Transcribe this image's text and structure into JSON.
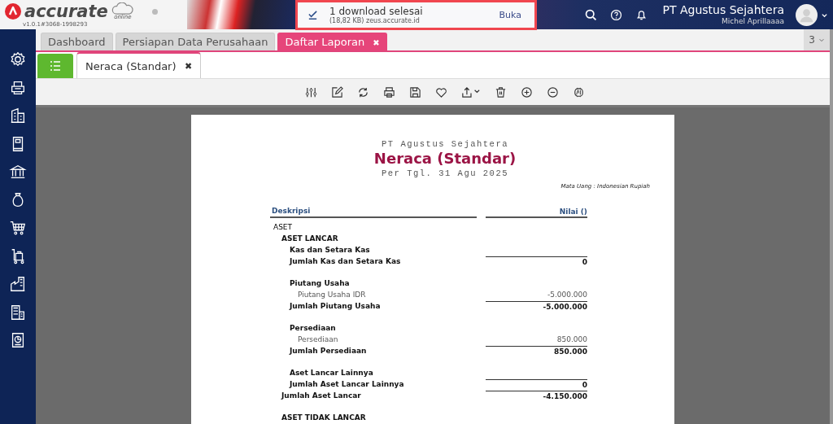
{
  "header": {
    "logo": "accurate",
    "logo_sub": "online",
    "version": "v1.0.1#3068-1998293",
    "company": "PT Agustus Sejahtera",
    "user": "Michel Aprillaaaa"
  },
  "download_popup": {
    "title": "1 download selesai",
    "detail": "(18,82 KB) zeus.accurate.id",
    "action": "Buka"
  },
  "tabs": [
    {
      "label": "Dashboard",
      "selected": false
    },
    {
      "label": "Persiapan Data Perusahaan",
      "selected": false
    },
    {
      "label": "Daftar Laporan",
      "selected": true,
      "close": "✖"
    }
  ],
  "tab_count": "3",
  "subtabs": [
    {
      "label": "Neraca (Standar)",
      "selected": true,
      "close": "✖"
    }
  ],
  "report": {
    "company": "PT Agustus Sejahtera",
    "title": "Neraca (Standar)",
    "date": "Per Tgl. 31 Agu 2025",
    "currency": "Mata Uang : Indonesian Rupiah",
    "columns": [
      "Deskripsi",
      "Nilai ()"
    ],
    "rows": [
      {
        "kind": "group",
        "label": "ASET",
        "children": [
          {
            "kind": "group",
            "label": "ASET LANCAR",
            "children": [
              {
                "kind": "group",
                "label": "Kas dan Setara Kas",
                "total": {
                  "label": "Jumlah Kas dan Setara Kas",
                  "value": "0"
                }
              },
              {
                "kind": "group",
                "label": "Piutang Usaha",
                "children": [
                  {
                    "kind": "account",
                    "label": "Piutang Usaha IDR",
                    "value": "-5.000.000"
                  }
                ],
                "total": {
                  "label": "Jumlah Piutang Usaha",
                  "value": "-5.000.000"
                }
              },
              {
                "kind": "group",
                "label": "Persediaan",
                "children": [
                  {
                    "kind": "account",
                    "label": "Persediaan",
                    "value": "850.000"
                  }
                ],
                "total": {
                  "label": "Jumlah Persediaan",
                  "value": "850.000"
                }
              },
              {
                "kind": "group",
                "label": "Aset Lancar Lainnya",
                "total": {
                  "label": "Jumlah Aset Lancar Lainnya",
                  "value": "0"
                }
              }
            ],
            "total": {
              "label": "Jumlah Aset Lancar",
              "value": "-4.150.000"
            }
          },
          {
            "kind": "group",
            "label": "ASET TIDAK LANCAR"
          }
        ]
      }
    ]
  }
}
